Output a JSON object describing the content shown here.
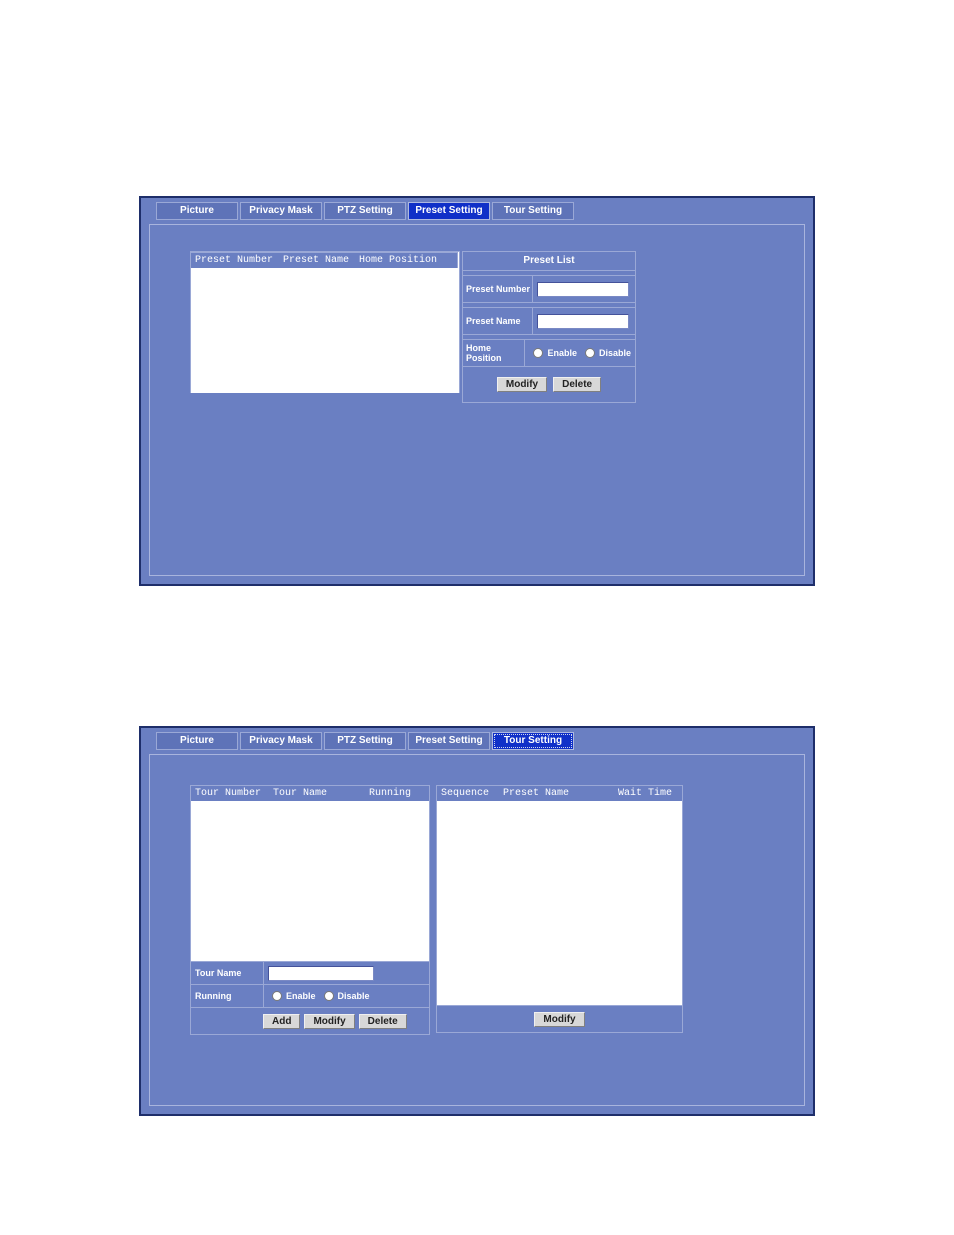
{
  "tabs": {
    "picture": "Picture",
    "privacy_mask": "Privacy Mask",
    "ptz_setting": "PTZ Setting",
    "preset_setting": "Preset Setting",
    "tour_setting": "Tour Setting"
  },
  "preset": {
    "list_headers": {
      "number": "Preset Number",
      "name": "Preset Name",
      "home": "Home Position"
    },
    "side_title": "Preset List",
    "labels": {
      "number": "Preset Number",
      "name": "Preset Name",
      "home": "Home Position"
    },
    "radio": {
      "enable": "Enable",
      "disable": "Disable"
    },
    "buttons": {
      "modify": "Modify",
      "delete": "Delete"
    },
    "values": {
      "number": "",
      "name": ""
    }
  },
  "tour": {
    "left_headers": {
      "number": "Tour Number",
      "name": "Tour Name",
      "running": "Running"
    },
    "right_headers": {
      "sequence": "Sequence",
      "preset_name": "Preset Name",
      "wait_time": "Wait Time"
    },
    "labels": {
      "tour_name": "Tour Name",
      "running": "Running"
    },
    "radio": {
      "enable": "Enable",
      "disable": "Disable"
    },
    "buttons": {
      "add": "Add",
      "modify": "Modify",
      "delete": "Delete",
      "modify_right": "Modify"
    },
    "values": {
      "tour_name": ""
    }
  }
}
